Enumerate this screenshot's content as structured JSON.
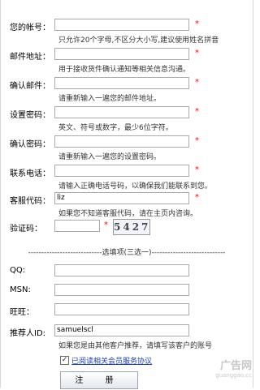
{
  "form": {
    "fields": [
      {
        "label": "您的帐号：",
        "value": "",
        "required": "*",
        "hint": "只允许20个字母,不区分大小写,建议使用姓名拼音"
      },
      {
        "label": "邮件地址：",
        "value": "",
        "required": "*",
        "hint": "用于接收货件确认通知等相关信息沟通。"
      },
      {
        "label": "确认邮件：",
        "value": "",
        "required": "*",
        "hint": "请重新输入一遍您的邮件地址。"
      },
      {
        "label": "设置密码：",
        "value": "",
        "required": "*",
        "hint": "英文、符号或数字，最少6位字符。"
      },
      {
        "label": "确认密码：",
        "value": "",
        "required": "*",
        "hint": "请重新输入一遍您的设置密码。"
      },
      {
        "label": "联系电话：",
        "value": "",
        "required": "*",
        "hint": "请输入正确电话号码，以确保我们能联系到您。"
      },
      {
        "label": "客服代码：",
        "value": "liz",
        "required": "*",
        "hint": "如果您不知道客服代码，请在主页内咨询。"
      }
    ],
    "captcha": {
      "label": "验证码：",
      "value": "",
      "required": "*",
      "image_text": "5427"
    },
    "optional_divider": "----------------------------选填项(三选一)----------------------------",
    "optional": [
      {
        "label": "QQ:",
        "value": ""
      },
      {
        "label": "MSN:",
        "value": ""
      },
      {
        "label": "旺旺：",
        "value": ""
      }
    ],
    "referrer": {
      "label": "推荐人ID:",
      "value": "samuelscl",
      "hint": "如果您是由其他客户推荐，请填写该客户的账号"
    },
    "agree": {
      "checked": "✓",
      "text": "已阅读相关会员服务协议"
    },
    "submit_label": "注 册"
  },
  "watermark": {
    "text": "广告网",
    "url": "guanggao.cc"
  }
}
